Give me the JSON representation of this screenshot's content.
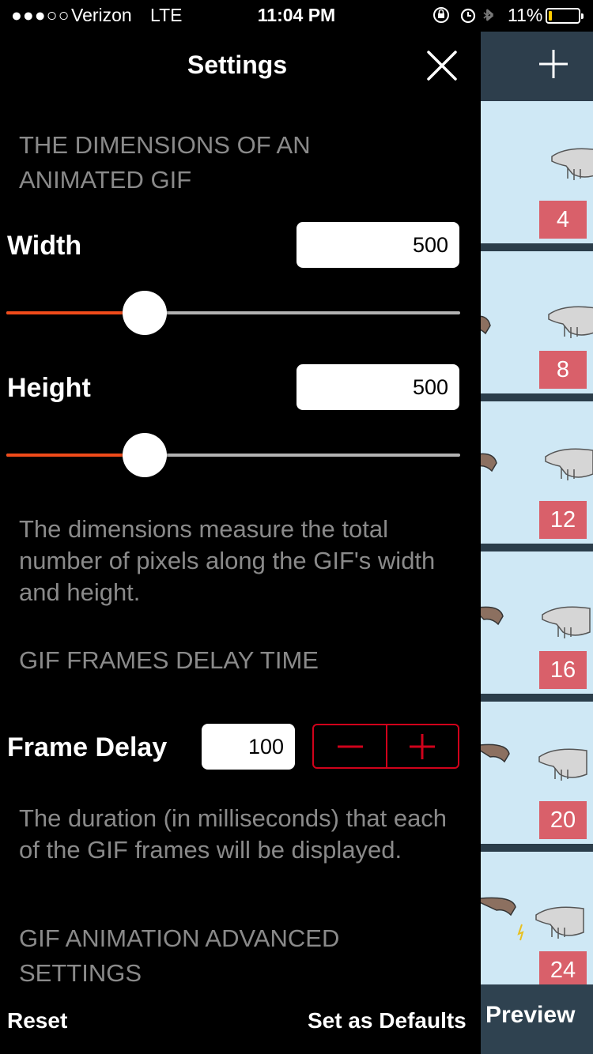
{
  "status_bar": {
    "signal": "●●●○○",
    "carrier": "Verizon",
    "network": "LTE",
    "time": "11:04 PM",
    "icons": "⊕ ◷ ∦",
    "battery_text": "11%",
    "battery_level": 0.11,
    "battery_color": "#ffcc00"
  },
  "settings": {
    "title": "Settings",
    "close_icon": "close-icon",
    "dimensions_header": "THE DIMENSIONS OF AN ANIMATED GIF",
    "width": {
      "label": "Width",
      "value": "500",
      "slider_fraction": 0.27
    },
    "height": {
      "label": "Height",
      "value": "500",
      "slider_fraction": 0.27
    },
    "dimensions_description": "The dimensions measure the total number of pixels along the GIF's width and height.",
    "delay_header": "GIF FRAMES DELAY TIME",
    "frame_delay": {
      "label": "Frame Delay",
      "value": "100",
      "minus_icon": "minus-icon",
      "plus_icon": "plus-icon"
    },
    "delay_description": "The duration (in milliseconds) that each of the GIF frames will be displayed.",
    "advanced_header": "GIF ANIMATION ADVANCED SETTINGS",
    "reset_label": "Reset",
    "defaults_label": "Set as Defaults"
  },
  "background_app": {
    "add_icon": "plus-icon",
    "frames": [
      "4",
      "8",
      "12",
      "16",
      "20",
      "24"
    ],
    "preview_label": "Preview"
  },
  "colors": {
    "slider_accent": "#f04b1a",
    "stepper_accent": "#d0021b",
    "frame_badge": "#d9606a",
    "frame_bg": "#cfe8f5"
  }
}
